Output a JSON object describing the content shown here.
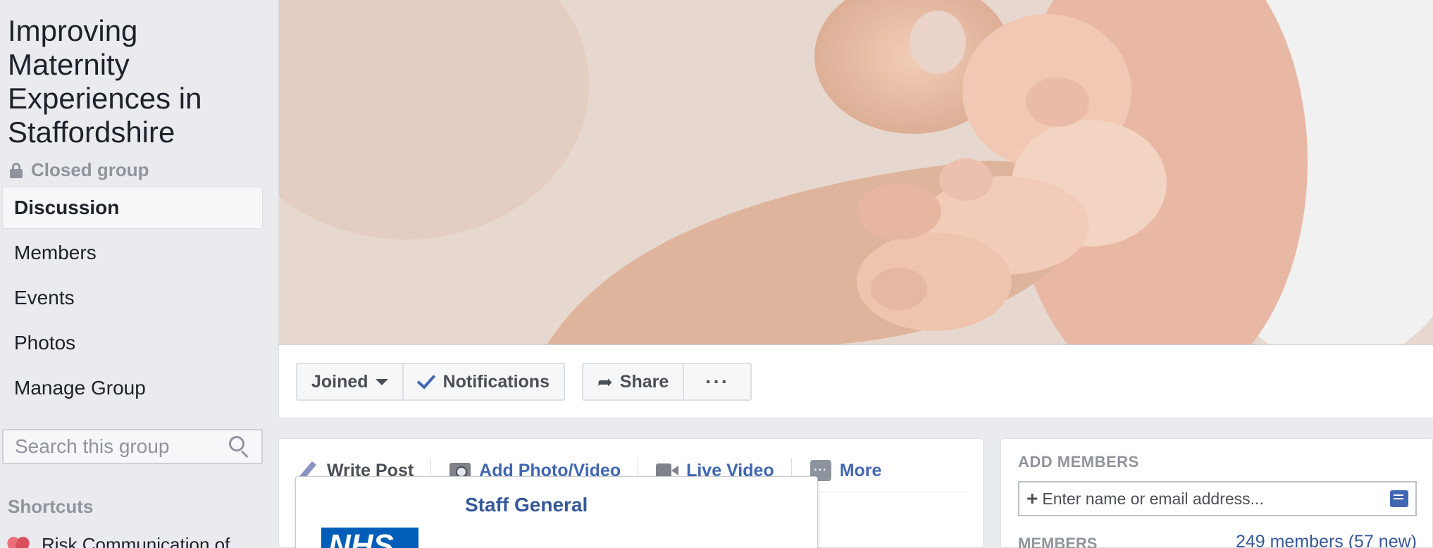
{
  "group": {
    "title": "Improving Maternity Experiences in Staffordshire",
    "privacy": "Closed group"
  },
  "sidebar": {
    "nav": [
      {
        "label": "Discussion",
        "active": true
      },
      {
        "label": "Members",
        "active": false
      },
      {
        "label": "Events",
        "active": false
      },
      {
        "label": "Photos",
        "active": false
      },
      {
        "label": "Manage Group",
        "active": false
      }
    ],
    "search_placeholder": "Search this group",
    "shortcuts_heading": "Shortcuts",
    "shortcut_item": "Risk Communication of"
  },
  "actions": {
    "joined": "Joined",
    "notifications": "Notifications",
    "share": "Share",
    "more_dots": "···"
  },
  "composer": {
    "tabs": [
      {
        "label": "Write Post",
        "icon": "pencil-icon"
      },
      {
        "label": "Add Photo/Video",
        "icon": "camera-icon"
      },
      {
        "label": "Live Video",
        "icon": "video-camera-icon"
      },
      {
        "label": "More",
        "icon": "more-icon"
      }
    ],
    "more_icon_glyph": "···",
    "popup_title": "Staff General",
    "popup_logo_text": "NHS"
  },
  "members_panel": {
    "add_heading": "ADD MEMBERS",
    "add_placeholder": "Enter name or email address...",
    "plus": "+",
    "members_heading": "MEMBERS",
    "members_count": "249 members (57 new)"
  },
  "colors": {
    "accent": "#4267b2",
    "link": "#365899",
    "background": "#e9ebee",
    "muted": "#90949c"
  }
}
